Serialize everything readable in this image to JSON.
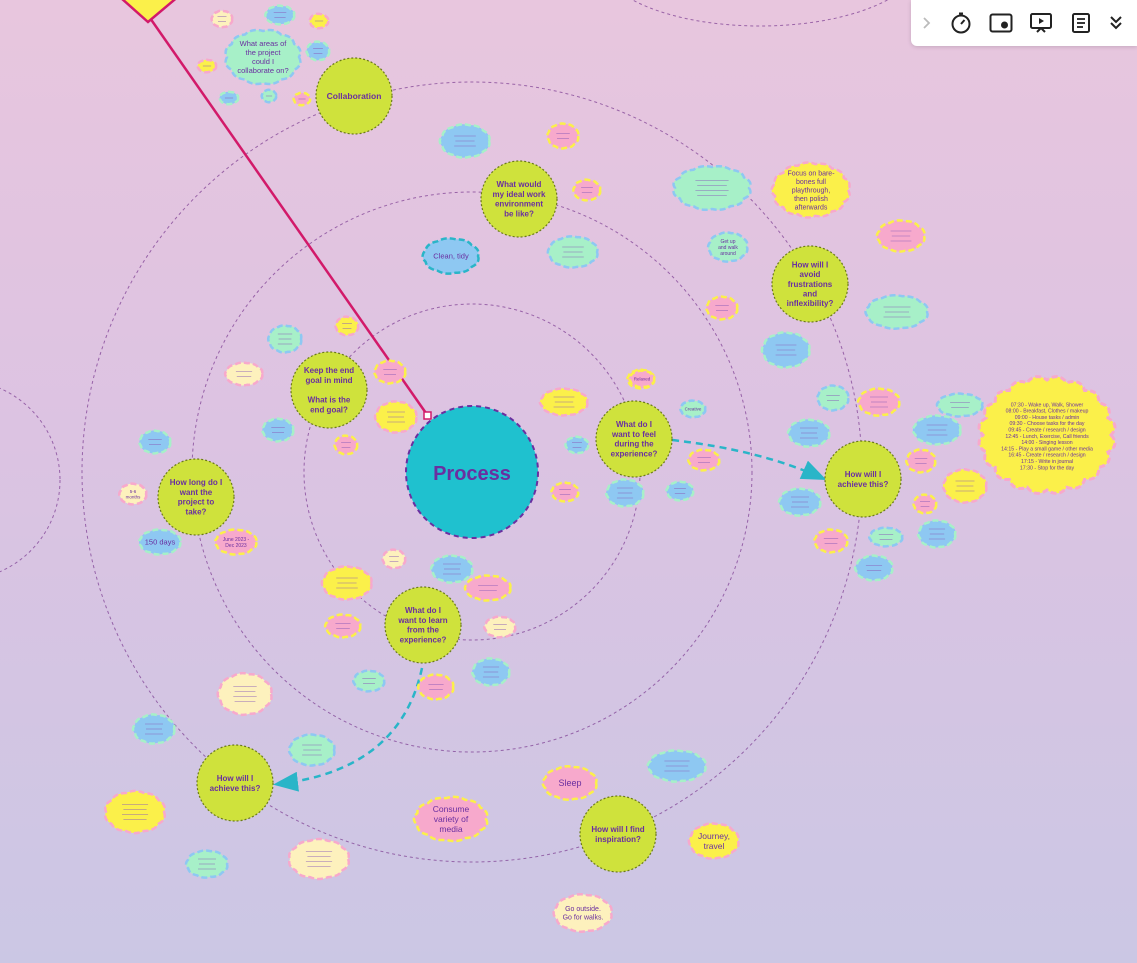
{
  "central": {
    "label": "Process"
  },
  "questions": [
    {
      "id": "q-collab",
      "lines": [
        "Collaboration"
      ]
    },
    {
      "id": "q-env",
      "lines": [
        "What would",
        "my ideal work",
        "environment",
        "be like?"
      ]
    },
    {
      "id": "q-avoid",
      "lines": [
        "How will I",
        "avoid",
        "frustrations",
        "and",
        "inflexibility?"
      ]
    },
    {
      "id": "q-goal",
      "lines": [
        "Keep the end",
        "goal in mind",
        "",
        "What is the",
        "end goal?"
      ]
    },
    {
      "id": "q-feel",
      "lines": [
        "What do I",
        "want to feel",
        "during the",
        "experience?"
      ]
    },
    {
      "id": "q-achieve-r",
      "lines": [
        "How will I",
        "achieve this?"
      ]
    },
    {
      "id": "q-long",
      "lines": [
        "How long do I",
        "want the",
        "project to",
        "take?"
      ]
    },
    {
      "id": "q-learn",
      "lines": [
        "What do I",
        "want to learn",
        "from the",
        "experience?"
      ]
    },
    {
      "id": "q-achieve-l",
      "lines": [
        "How will I",
        "achieve this?"
      ]
    },
    {
      "id": "q-inspire",
      "lines": [
        "How will I find",
        "inspiration?"
      ]
    }
  ],
  "notes": [
    {
      "id": "n-collab",
      "lines": [
        "What areas of",
        "the project",
        "could I",
        "collaborate on?"
      ]
    },
    {
      "id": "n-focus",
      "lines": [
        "Focus on bare-",
        "bones full",
        "playthrough,",
        "then polish",
        "afterwards"
      ]
    },
    {
      "id": "n-clean",
      "lines": [
        "Clean, tidy"
      ]
    },
    {
      "id": "n-days",
      "lines": [
        "150 days"
      ]
    },
    {
      "id": "n-sleep",
      "lines": [
        "Sleep"
      ]
    },
    {
      "id": "n-media",
      "lines": [
        "Consume",
        "variety of",
        "media"
      ]
    },
    {
      "id": "n-journey",
      "lines": [
        "Journey,",
        "travel"
      ]
    },
    {
      "id": "n-outside",
      "lines": [
        "Go outside.",
        "Go for walks."
      ]
    },
    {
      "id": "n-relaxed",
      "lines": [
        "Relaxed"
      ]
    },
    {
      "id": "n-creative",
      "lines": [
        "Creative"
      ]
    },
    {
      "id": "n-date",
      "lines": [
        "June 2023 -",
        "Dec 2023"
      ]
    },
    {
      "id": "n-months",
      "lines": [
        "5-6",
        "months"
      ]
    },
    {
      "id": "n-walls",
      "lines": [
        "Get up",
        "and walk",
        "around"
      ]
    }
  ],
  "schedule": {
    "lines": [
      "07:30 - Wake up, Walk, Shower",
      "08:00 - Breakfast, Clothes / makeup",
      "09:00 - House tasks / admin",
      "09:30 - Choose tasks for the day",
      "09:45 - Create / research / design",
      "12:45 - Lunch, Exercise, Call friends",
      "14:00 - Singing lesson",
      "14:15 - Play a small game / other media",
      "16:45 - Create / research / design",
      "17:15 - Write in journal",
      "17:30 - Stop for the day"
    ]
  },
  "toolbar": {
    "buttons": [
      {
        "name": "collapse-chevron-icon",
        "interactable": true
      },
      {
        "name": "timer-icon",
        "interactable": true
      },
      {
        "name": "frame-icon",
        "interactable": true
      },
      {
        "name": "presentation-icon",
        "interactable": true
      },
      {
        "name": "notes-icon",
        "interactable": true
      },
      {
        "name": "more-chevron-icon",
        "interactable": true
      }
    ]
  },
  "colors": {
    "question_fill": "#cfe23c",
    "central_fill": "#1fc1cf",
    "text": "#6a2fa0",
    "connector_dashed": "#2ab5c8",
    "arrow_line": "#d21a6a",
    "yellow_note": "#fbf04a",
    "pink_note": "#f7a9cc",
    "blue_note": "#8ec8f2",
    "mint_note": "#a7f0c8",
    "cream_note": "#fdf1bd"
  }
}
